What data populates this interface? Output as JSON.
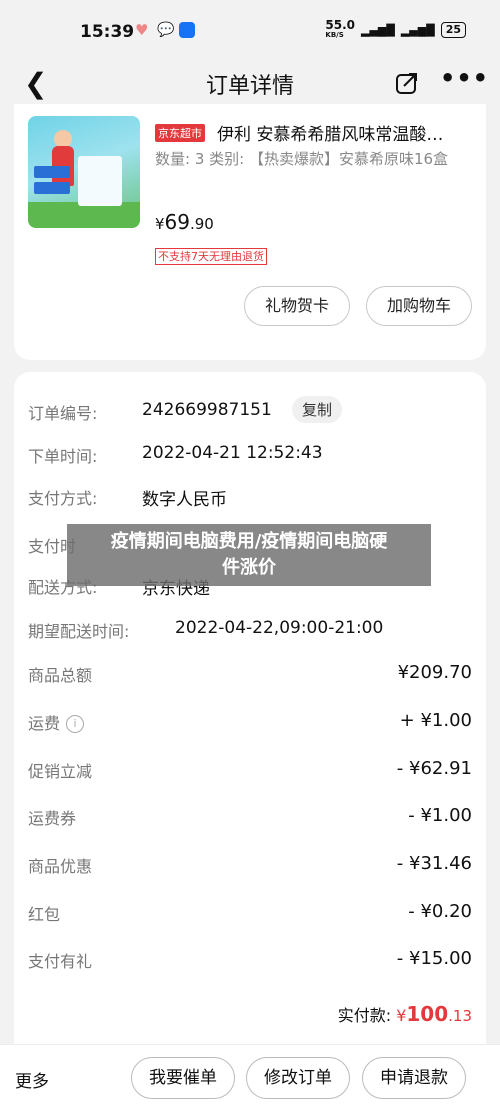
{
  "status": {
    "time": "15:39",
    "net_speed": "55.0",
    "net_unit": "KB/S",
    "battery": "25"
  },
  "header": {
    "title": "订单详情"
  },
  "product": {
    "badge": "京东超市",
    "name": "伊利 安慕希希腊风味常温酸…",
    "spec": "数量: 3  类别: 【热卖爆款】安慕希原味16盒",
    "price_symbol": "¥",
    "price_int": "69",
    "price_dec": ".90",
    "return_policy": "不支持7天无理由退货",
    "gift_button": "礼物贺卡",
    "cart_button": "加购物车"
  },
  "order_info": {
    "order_no_label": "订单编号:",
    "order_no": "242669987151",
    "copy_label": "复制",
    "time_label": "下单时间:",
    "time": "2022-04-21 12:52:43",
    "pay_label": "支付方式:",
    "pay": "数字人民币",
    "pay_time_label": "支付时",
    "ship_label": "配送方式:",
    "ship": "京东快递",
    "delivery_label": "期望配送时间:",
    "delivery": "2022-04-22,09:00-21:00"
  },
  "amounts": [
    {
      "label": "商品总额",
      "value": "¥209.70"
    },
    {
      "label": "运费",
      "value": "+ ¥1.00"
    },
    {
      "label": "促销立减",
      "value": "- ¥62.91"
    },
    {
      "label": "运费券",
      "value": "- ¥1.00"
    },
    {
      "label": "商品优惠",
      "value": "- ¥31.46"
    },
    {
      "label": "红包",
      "value": "- ¥0.20"
    },
    {
      "label": "支付有礼",
      "value": "- ¥15.00"
    }
  ],
  "total": {
    "label": "实付款:",
    "symbol": "¥",
    "int": "100",
    "dec": ".13"
  },
  "bottom": {
    "more": "更多",
    "urge": "我要催单",
    "modify": "修改订单",
    "refund": "申请退款"
  },
  "overlay": {
    "line1": "疫情期间电脑费用/疫情期间电脑硬",
    "line2": "件涨价"
  },
  "colors": {
    "accent_red": "#e4393c",
    "background": "#f2f2f2"
  }
}
